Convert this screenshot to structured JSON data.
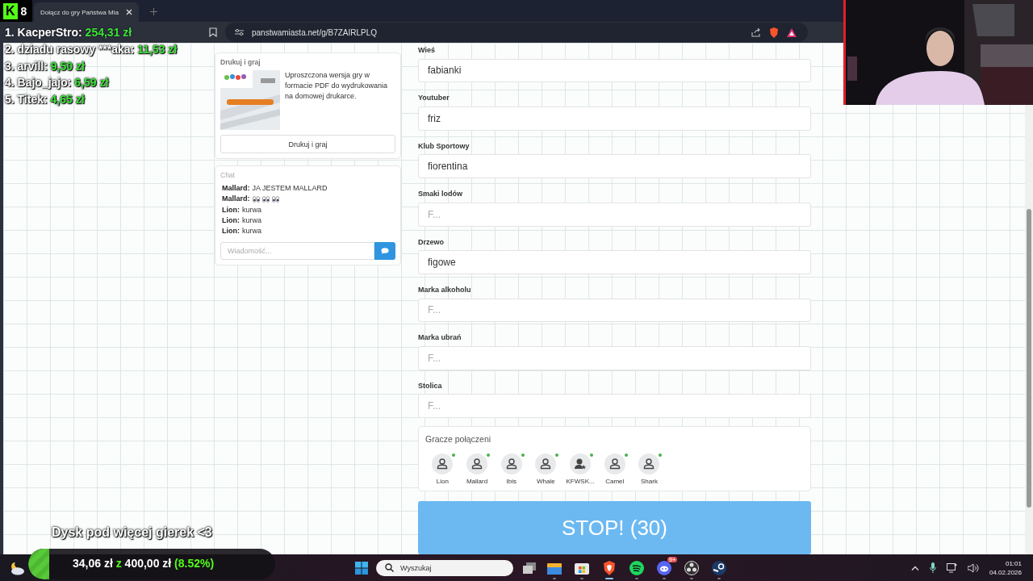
{
  "browser": {
    "tab_title": "Dołącz do gry Państwa Mia",
    "url": "panstwamiasta.net/g/B7ZAIRLPLQ"
  },
  "print_card": {
    "title": "Drukuj i graj",
    "description": "Uproszczona wersja gry w formacie PDF do wydrukowania na domowej drukarce.",
    "button": "Drukuj i graj"
  },
  "chat": {
    "title": "Chat",
    "placeholder": "Wiadomość...",
    "messages": [
      {
        "author": "Mallard:",
        "text": "JA JESTEM MALLARD"
      },
      {
        "author": "Mallard:",
        "emoji": [
          {
            "kind": "eyes"
          },
          {
            "kind": "eyes"
          },
          {
            "kind": "eyes"
          }
        ]
      },
      {
        "author": "Lion:",
        "text": "kurwa"
      },
      {
        "author": "Lion:",
        "text": "kurwa"
      },
      {
        "author": "Lion:",
        "text": "kurwa"
      }
    ]
  },
  "fields": [
    {
      "label": "Wieś",
      "value": "fabianki"
    },
    {
      "label": "Youtuber",
      "value": "friz"
    },
    {
      "label": "Klub Sportowy",
      "value": "fiorentina"
    },
    {
      "label": "Smaki lodów",
      "placeholder": "F..."
    },
    {
      "label": "Drzewo",
      "value": "figowe"
    },
    {
      "label": "Marka alkoholu",
      "placeholder": "F..."
    },
    {
      "label": "Marka ubrań",
      "placeholder": "F..."
    },
    {
      "label": "Stolica",
      "placeholder": "F..."
    }
  ],
  "players": {
    "title": "Gracze połączeni",
    "items": [
      {
        "name": "Lion",
        "kind": "player",
        "online": true
      },
      {
        "name": "Mallard",
        "kind": "player",
        "online": true
      },
      {
        "name": "Ibis",
        "kind": "player",
        "online": true
      },
      {
        "name": "Whale",
        "kind": "player",
        "online": true
      },
      {
        "name": "KFWSK...",
        "kind": "host",
        "online": true
      },
      {
        "name": "Camel",
        "kind": "player",
        "online": true
      },
      {
        "name": "Shark",
        "kind": "player",
        "online": true
      }
    ]
  },
  "stop_button": "STOP! (30)",
  "overlay": {
    "logo_letter": "K",
    "logo_number": "8",
    "leaderboard": [
      {
        "rank": "1.",
        "name": "KacperStro:",
        "amount": "254,31 zł"
      },
      {
        "rank": "2.",
        "name": "dziadu rasowy ***aka:",
        "amount": "11,53 zł"
      },
      {
        "rank": "3.",
        "name": "arvill:",
        "amount": "9,50 zł"
      },
      {
        "rank": "4.",
        "name": "Bajo_jajo:",
        "amount": "6,59 zł"
      },
      {
        "rank": "5.",
        "name": "Titek:",
        "amount": "4,65 zł"
      }
    ],
    "caption": "Dysk pod więcej gierek <3",
    "goal": {
      "raised": "34,06 zł",
      "joiner": "z",
      "target": "400,00 zł",
      "percent": "(8.52%)",
      "level": 0.0852
    }
  },
  "taskbar": {
    "search_placeholder": "Wyszukaj",
    "apps": [
      {
        "kind": "explorer",
        "active": false
      },
      {
        "kind": "store",
        "active": false
      },
      {
        "kind": "brave",
        "active": true
      },
      {
        "kind": "spotify",
        "active": false
      },
      {
        "kind": "discord",
        "active": false,
        "badge": "9+"
      },
      {
        "kind": "obs",
        "active": false
      },
      {
        "kind": "steam",
        "active": false
      }
    ],
    "time": "01:01",
    "date": "04.02.2026"
  }
}
